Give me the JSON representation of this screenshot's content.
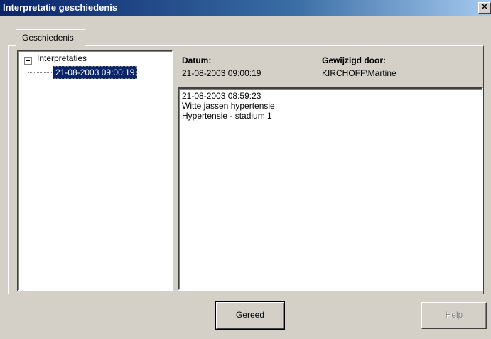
{
  "window": {
    "title": "Interpretatie geschiedenis",
    "close_glyph": "✕"
  },
  "tabs": [
    {
      "label": "Geschiedenis"
    }
  ],
  "tree": {
    "root_label": "Interpretaties",
    "children": [
      {
        "label": "21-08-2003 09:00:19",
        "selected": true
      }
    ]
  },
  "details": {
    "date_header": "Datum:",
    "date_value": "21-08-2003 09:00:19",
    "modified_header": "Gewijzigd door:",
    "modified_value": "KIRCHOFF\\Martine",
    "lines": [
      "21-08-2003 08:59:23",
      "Witte jassen hypertensie",
      "Hypertensie - stadium 1"
    ]
  },
  "buttons": {
    "done": "Gereed",
    "help": "Help"
  },
  "colors": {
    "titlebar_start": "#0a246a",
    "titlebar_end": "#a6caf0",
    "face": "#d4d0c8",
    "selection": "#0a246a"
  }
}
